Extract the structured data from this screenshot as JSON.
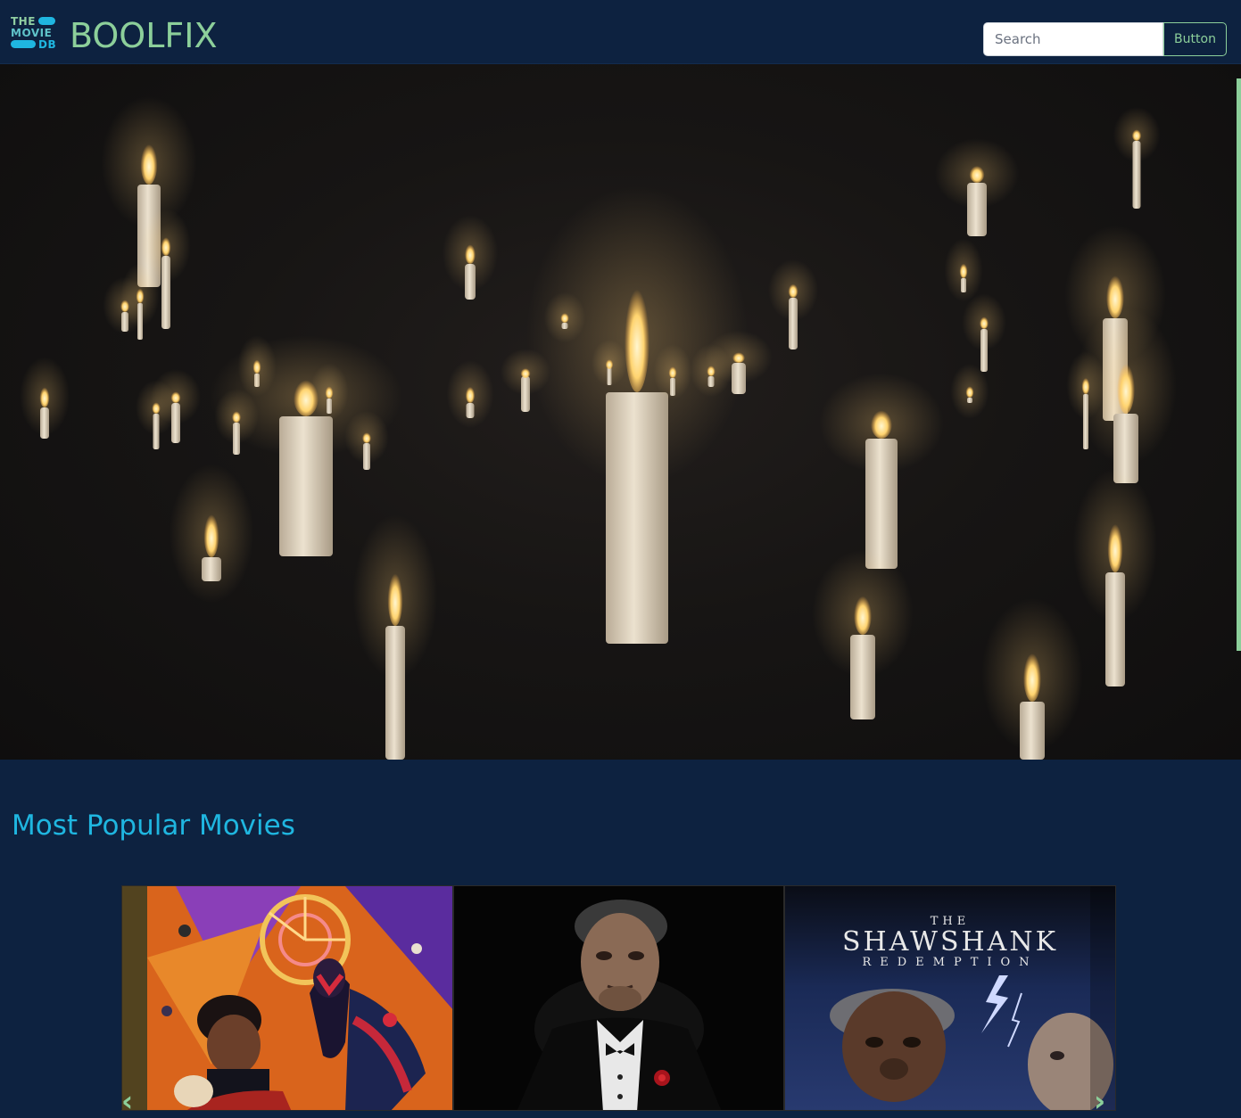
{
  "navbar": {
    "logo_lines": [
      "THE",
      "MOVIE",
      "DB"
    ],
    "brand": "BOOLFIX",
    "search": {
      "placeholder": "Search",
      "value": ""
    },
    "button_label": "Button"
  },
  "hero": {
    "kind": "video"
  },
  "section": {
    "title": "Most Popular Movies"
  },
  "carousel": {
    "cards": [
      {
        "poster": "spider-verse-poster"
      },
      {
        "poster": "godfather-poster"
      },
      {
        "poster": "shawshank-poster",
        "title_top": "THE",
        "title_main": "SHAWSHANK",
        "title_sub": "REDEMPTION"
      }
    ],
    "prev_icon": "chevron-left-icon",
    "next_icon": "chevron-right-icon"
  },
  "colors": {
    "background": "#0d2240",
    "brand": "#8ccf9a",
    "heading": "#1fb6e0",
    "tmdb_teal": "#90cea1",
    "tmdb_blue": "#01b4e4"
  }
}
